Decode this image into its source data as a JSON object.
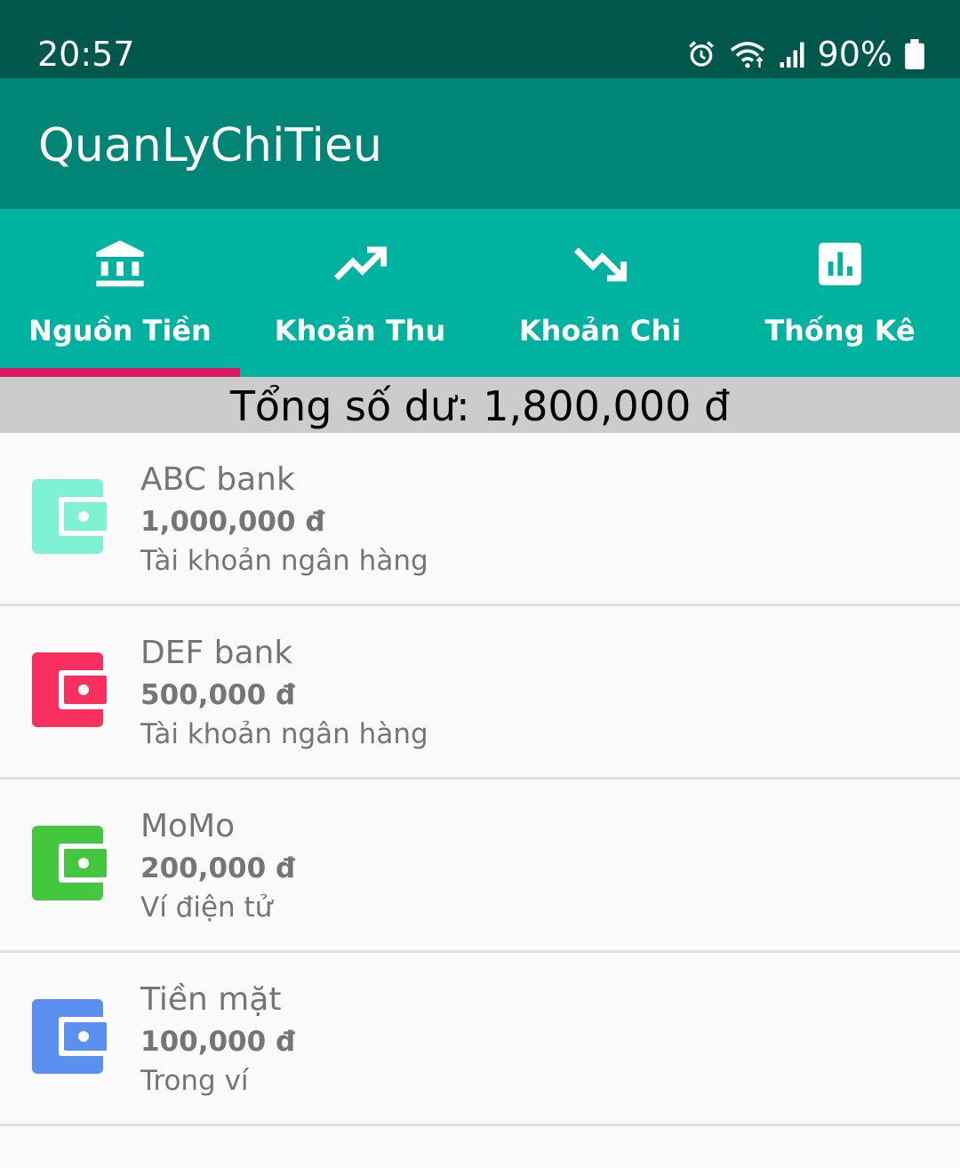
{
  "status_bar": {
    "time": "20:57",
    "battery": "90%",
    "icons": [
      "alarm-icon",
      "wifi-icon",
      "signal-icon",
      "battery-icon"
    ]
  },
  "app": {
    "title": "QuanLyChiTieu",
    "colors": {
      "status": "#00574b",
      "primary": "#008577",
      "tabs": "#00b3a0",
      "accent": "#d81b60"
    }
  },
  "tabs": [
    {
      "label": "Nguồn Tiền",
      "icon": "bank-icon",
      "selected": true
    },
    {
      "label": "Khoản Thu",
      "icon": "trending-up-icon",
      "selected": false
    },
    {
      "label": "Khoản Chi",
      "icon": "trending-down-icon",
      "selected": false
    },
    {
      "label": "Thống Kê",
      "icon": "bar-chart-icon",
      "selected": false
    }
  ],
  "summary": {
    "total_text": "Tổng số dư: 1,800,000 đ"
  },
  "accounts": [
    {
      "name": "ABC bank",
      "amount": "1,000,000 đ",
      "type": "Tài khoản ngân hàng",
      "icon": "wallet-icon",
      "color": "#7ff2d4"
    },
    {
      "name": "DEF bank",
      "amount": "500,000 đ",
      "type": "Tài khoản ngân hàng",
      "icon": "wallet-icon",
      "color": "#f92f5f"
    },
    {
      "name": "MoMo",
      "amount": "200,000 đ",
      "type": "Ví điện tử",
      "icon": "wallet-icon",
      "color": "#44c63e"
    },
    {
      "name": "Tiền mặt",
      "amount": "100,000 đ",
      "type": "Trong ví",
      "icon": "wallet-icon",
      "color": "#5b8ff0"
    }
  ]
}
